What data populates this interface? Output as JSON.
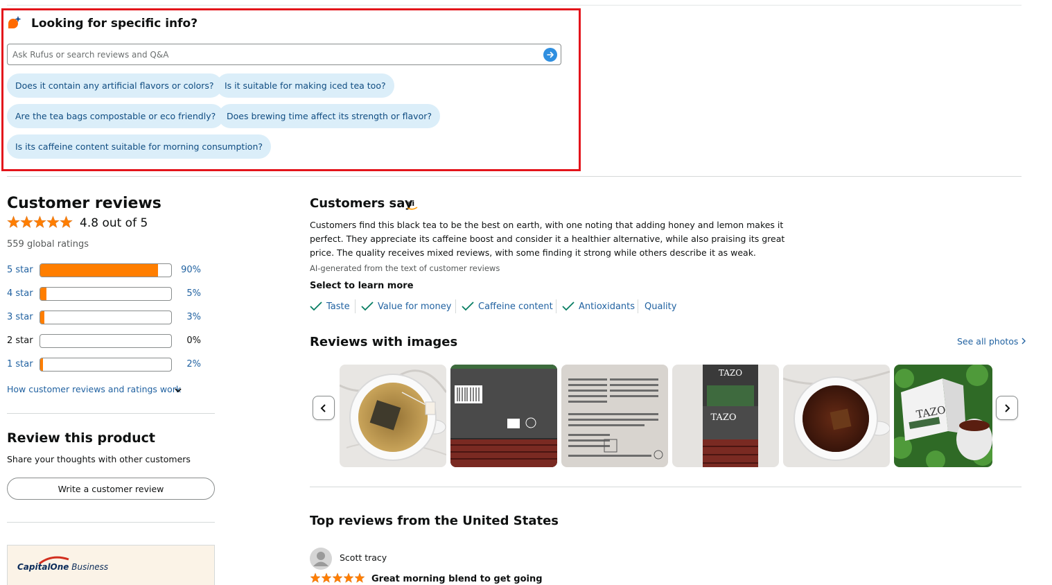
{
  "rufus": {
    "title": "Looking for specific info?",
    "search_placeholder": "Ask Rufus or search reviews and Q&A",
    "suggestions": [
      "Does it contain any artificial flavors or colors?",
      "Is it suitable for making iced tea too?",
      "Are the tea bags compostable or eco friendly?",
      "Does brewing time affect its strength or flavor?",
      "Is its caffeine content suitable for morning consumption?"
    ]
  },
  "reviews_summary": {
    "title": "Customer reviews",
    "rating_text": "4.8 out of 5",
    "rating": 4.8,
    "global_ratings": "559 global ratings",
    "histogram": [
      {
        "label": "5 star",
        "pct": "90%",
        "value": 90
      },
      {
        "label": "4 star",
        "pct": "5%",
        "value": 5
      },
      {
        "label": "3 star",
        "pct": "3%",
        "value": 3
      },
      {
        "label": "2 star",
        "pct": "0%",
        "value": 0
      },
      {
        "label": "1 star",
        "pct": "2%",
        "value": 2
      }
    ],
    "how_link": "How customer reviews and ratings work"
  },
  "review_product": {
    "title": "Review this product",
    "subtitle": "Share your thoughts with other customers",
    "button": "Write a customer review"
  },
  "ad": {
    "brand": "CapitalOne",
    "product": "Business"
  },
  "customers_say": {
    "title": "Customers say",
    "body": "Customers find this black tea to be the best on earth, with one noting that adding honey and lemon makes it perfect. They appreciate its caffeine boost and consider it a healthier alternative, while also praising its great price. The quality receives mixed reviews, with some finding it strong while others describe it as weak.",
    "note": "AI-generated from the text of customer reviews",
    "select_title": "Select to learn more",
    "aspects": [
      "Taste",
      "Value for money",
      "Caffeine content",
      "Antioxidants",
      "Quality"
    ]
  },
  "images": {
    "title": "Reviews with images",
    "see_all": "See all photos"
  },
  "top_reviews": {
    "title": "Top reviews from the United States",
    "first": {
      "reviewer": "Scott tracy",
      "stars": 5,
      "headline": "Great morning blend to get going"
    }
  },
  "colors": {
    "accent_orange": "#ff7e00",
    "link_blue": "#2162A1",
    "highlight_red": "#e3141b",
    "chip_bg": "#dbeef9"
  }
}
